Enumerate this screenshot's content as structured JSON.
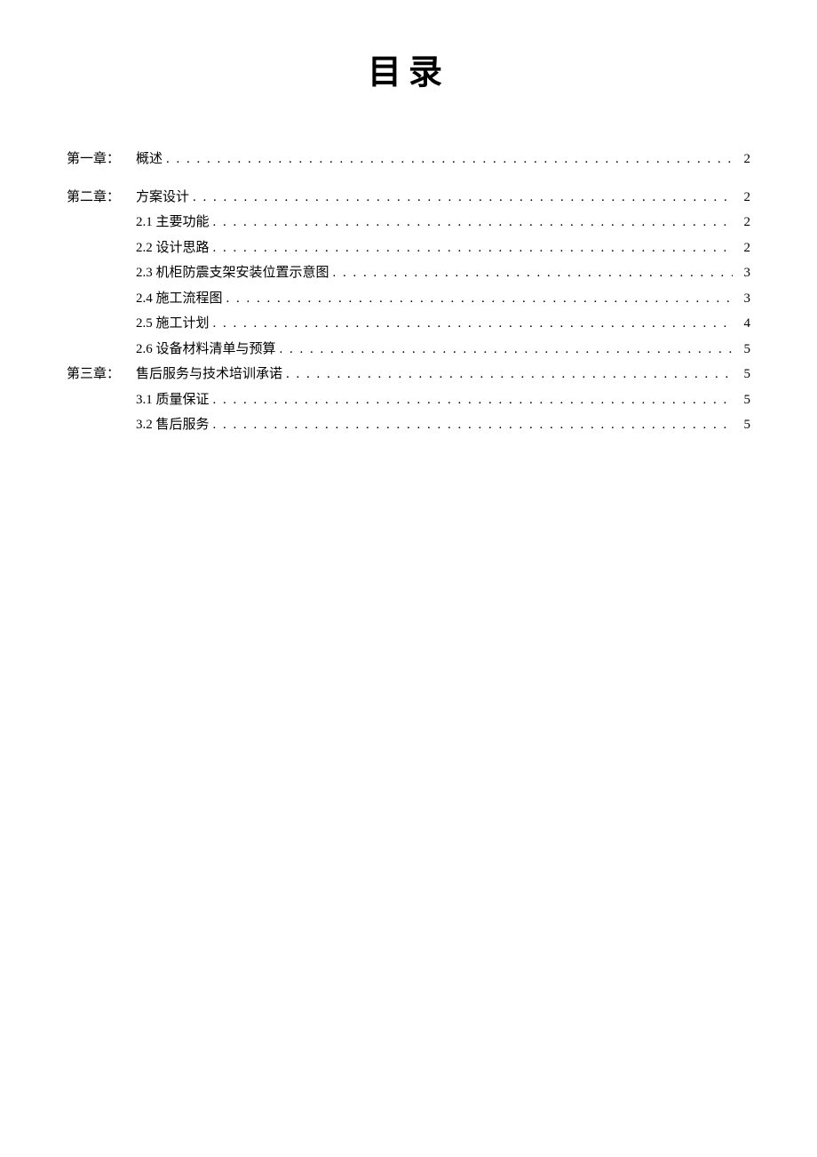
{
  "title": "目录",
  "entries": [
    {
      "prefix": "第一章：",
      "label": "概述",
      "page": "2",
      "level": 1,
      "spaced": false
    },
    {
      "prefix": "第二章：",
      "label": "方案设计",
      "page": "2",
      "level": 1,
      "spaced": true
    },
    {
      "prefix": "",
      "label": "2.1 主要功能",
      "page": "2",
      "level": 2,
      "spaced": false
    },
    {
      "prefix": "",
      "label": "2.2 设计思路",
      "page": "2",
      "level": 2,
      "spaced": false
    },
    {
      "prefix": "",
      "label": "2.3 机柜防震支架安装位置示意图",
      "page": "3",
      "level": 2,
      "spaced": false
    },
    {
      "prefix": "",
      "label": "2.4 施工流程图",
      "page": "3",
      "level": 2,
      "spaced": false
    },
    {
      "prefix": "",
      "label": "2.5 施工计划",
      "page": "4",
      "level": 2,
      "spaced": false
    },
    {
      "prefix": "",
      "label": "2.6 设备材料清单与预算",
      "page": "5",
      "level": 2,
      "spaced": false
    },
    {
      "prefix": "第三章：",
      "label": "售后服务与技术培训承诺",
      "page": "5",
      "level": 1,
      "spaced": false
    },
    {
      "prefix": "",
      "label": "3.1 质量保证",
      "page": "5",
      "level": 2,
      "spaced": false
    },
    {
      "prefix": "",
      "label": "3.2 售后服务",
      "page": "5",
      "level": 2,
      "spaced": false
    }
  ]
}
